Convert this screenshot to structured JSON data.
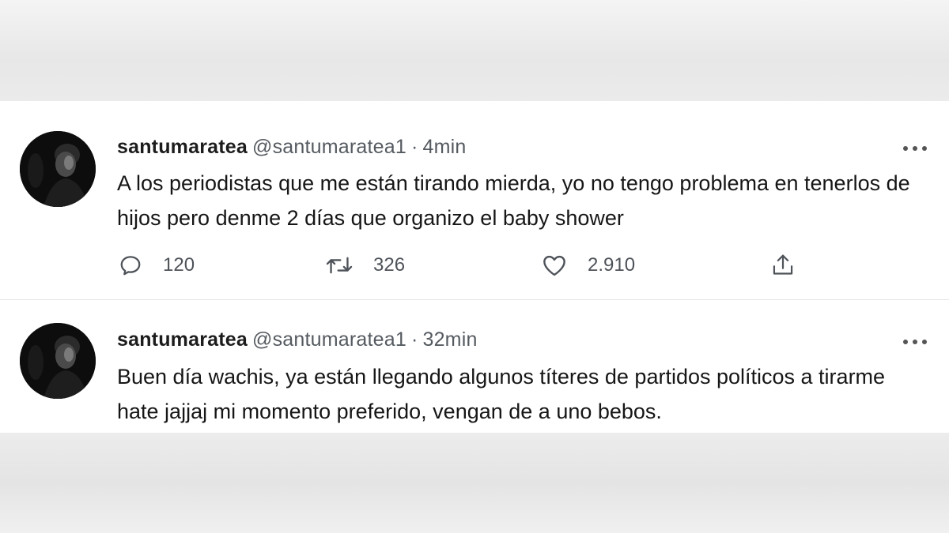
{
  "tweets": [
    {
      "display_name": "santumaratea",
      "handle": "@santumaratea1",
      "separator": "·",
      "time": "4min",
      "text": "A los periodistas que me están tirando mierda, yo no tengo problema en tenerlos de hijos pero denme 2 días que organizo el baby shower",
      "replies": "120",
      "retweets": "326",
      "likes": "2.910"
    },
    {
      "display_name": "santumaratea",
      "handle": "@santumaratea1",
      "separator": "·",
      "time": "32min",
      "text": "Buen día wachis, ya están llegando algunos títeres de partidos políticos a tirarme hate jajjaj mi momento preferido, vengan de a uno bebos."
    }
  ],
  "icons": {
    "reply": "reply-icon",
    "retweet": "retweet-icon",
    "like": "heart-icon",
    "share": "share-icon",
    "more": "more-options-icon"
  },
  "colors": {
    "text": "#161616",
    "muted": "#555a60",
    "card_bg": "#ffffff"
  }
}
